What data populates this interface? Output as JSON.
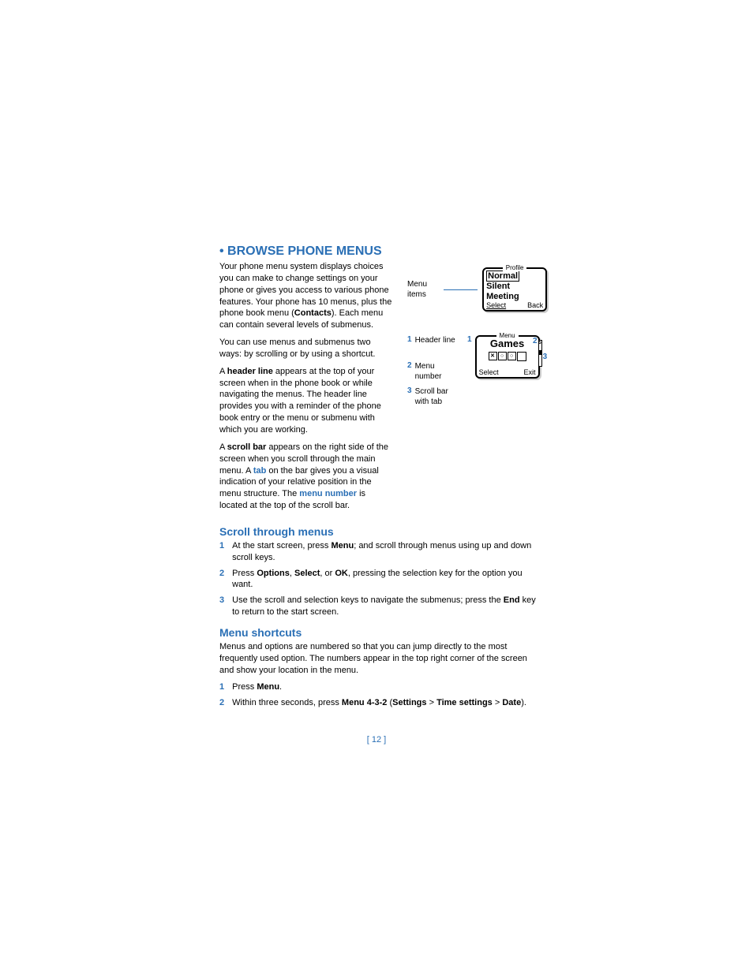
{
  "headings": {
    "main": "BROWSE PHONE MENUS",
    "scroll": "Scroll through menus",
    "shortcuts": "Menu shortcuts"
  },
  "para": {
    "p1_a": "Your phone menu system displays choices you can make to change settings on your phone or gives you access to various phone features. Your phone has 10 menus, plus the phone book menu (",
    "p1_bold": "Contacts",
    "p1_b": "). Each menu can contain several levels of submenus.",
    "p2": "You can use menus and submenus two ways: by scrolling or by using a shortcut.",
    "p3_a": "A ",
    "p3_bold": "header line",
    "p3_b": " appears at the top of your screen when in the phone book or while navigating the menus. The header line provides you with a reminder of the phone book entry or the menu or submenu with which you are working.",
    "p4_a": "A ",
    "p4_bold": "scroll bar",
    "p4_b": " appears on the right side of the screen when you scroll through the main menu. A ",
    "p4_blue1": "tab",
    "p4_c": " on the bar gives you a visual indication of your relative position in the menu structure. The ",
    "p4_blue2": "menu number",
    "p4_d": " is located at the top of the scroll bar.",
    "shortcuts_intro": "Menus and options are numbered so that you can jump directly to the most frequently used option. The numbers appear in the top right corner of the screen and show your location in the menu."
  },
  "steps_scroll": {
    "s1_a": "At the start screen, press ",
    "s1_bold": "Menu",
    "s1_b": "; and scroll through menus using up and down scroll keys.",
    "s2_a": "Press ",
    "s2_b1": "Options",
    "s2_c": ", ",
    "s2_b2": "Select",
    "s2_d": ", or ",
    "s2_b3": "OK",
    "s2_e": ", pressing the selection key for the option you want.",
    "s3_a": "Use the scroll and selection keys to navigate the submenus; press the ",
    "s3_bold": "End",
    "s3_b": " key to return to the start screen."
  },
  "steps_short": {
    "s1_a": "Press ",
    "s1_bold": "Menu",
    "s1_b": ".",
    "s2_a": "Within three seconds, press ",
    "s2_b1": "Menu 4-3-2",
    "s2_b": " (",
    "s2_b2": "Settings",
    "s2_gt1": " > ",
    "s2_b3": "Time settings",
    "s2_gt2": " > ",
    "s2_b4": "Date",
    "s2_c": ")."
  },
  "callouts": {
    "menu_items": "Menu items",
    "c1": "Header line",
    "c2": "Menu number",
    "c3": "Scroll bar with tab",
    "n1": "1",
    "n2": "2",
    "n3": "3"
  },
  "screen1": {
    "header": "Profile",
    "item1": "Normal",
    "item2": "Silent",
    "item3": "Meeting",
    "left": "Select",
    "right": "Back"
  },
  "screen2": {
    "header": "Menu",
    "title": "Games",
    "num": "5",
    "left": "Select",
    "right": "Exit"
  },
  "page_number": "[ 12 ]"
}
